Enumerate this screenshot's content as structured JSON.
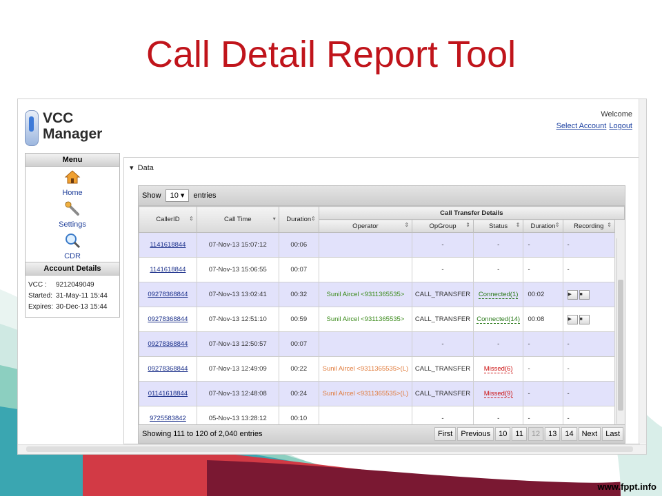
{
  "slide": {
    "title": "Call Detail Report Tool",
    "footer": "www.fppt.info"
  },
  "app": {
    "name_line1": "VCC",
    "name_line2": "Manager"
  },
  "header": {
    "welcome": "Welcome",
    "select_account": "Select Account",
    "logout": "Logout"
  },
  "sidebar": {
    "menu_title": "Menu",
    "items": [
      {
        "label": "Home",
        "icon": "home-icon"
      },
      {
        "label": "Settings",
        "icon": "wrench-icon"
      },
      {
        "label": "CDR",
        "icon": "magnifier-icon"
      }
    ],
    "account_title": "Account Details",
    "account": [
      {
        "k": "VCC :",
        "v": "9212049049"
      },
      {
        "k": "Started:",
        "v": "31-May-11 15:44"
      },
      {
        "k": "Expires:",
        "v": "30-Dec-13 15:44"
      }
    ]
  },
  "panel": {
    "title": "Data"
  },
  "table": {
    "show": "Show",
    "page_size": "10",
    "entries": "entries",
    "group_header": "Call Transfer Details",
    "columns": [
      "CallerID",
      "Call Time",
      "Duration",
      "Operator",
      "OpGroup",
      "Status",
      "Duration",
      "Recording"
    ],
    "rows": [
      {
        "caller": "1141618844",
        "time": "07-Nov-13 15:07:12",
        "dur": "00:06",
        "op": "",
        "opgroup": "-",
        "status": "-",
        "sdur": "-",
        "rec": "-",
        "style": "blue"
      },
      {
        "caller": "1141618844",
        "time": "07-Nov-13 15:06:55",
        "dur": "00:07",
        "op": "",
        "opgroup": "-",
        "status": "-",
        "sdur": "-",
        "rec": "-",
        "style": "white"
      },
      {
        "caller": "09278368844",
        "time": "07-Nov-13 13:02:41",
        "dur": "00:32",
        "op": "Sunil Aircel <9311365535>",
        "opgroup": "CALL_TRANSFER",
        "status": "Connected(1)",
        "sdur": "00:02",
        "rec": "play",
        "style": "blue",
        "opc": "green",
        "stc": "green"
      },
      {
        "caller": "09278368844",
        "time": "07-Nov-13 12:51:10",
        "dur": "00:59",
        "op": "Sunil Aircel <9311365535>",
        "opgroup": "CALL_TRANSFER",
        "status": "Connected(14)",
        "sdur": "00:08",
        "rec": "play",
        "style": "white",
        "opc": "green",
        "stc": "green"
      },
      {
        "caller": "09278368844",
        "time": "07-Nov-13 12:50:57",
        "dur": "00:07",
        "op": "",
        "opgroup": "-",
        "status": "-",
        "sdur": "-",
        "rec": "-",
        "style": "blue"
      },
      {
        "caller": "09278368844",
        "time": "07-Nov-13 12:49:09",
        "dur": "00:22",
        "op": "Sunil Aircel <9311365535>(L)",
        "opgroup": "CALL_TRANSFER",
        "status": "Missed(6)",
        "sdur": "-",
        "rec": "-",
        "style": "white",
        "opc": "orange",
        "stc": "red"
      },
      {
        "caller": "01141618844",
        "time": "07-Nov-13 12:48:08",
        "dur": "00:24",
        "op": "Sunil Aircel <9311365535>(L)",
        "opgroup": "CALL_TRANSFER",
        "status": "Missed(9)",
        "sdur": "-",
        "rec": "-",
        "style": "blue",
        "opc": "orange",
        "stc": "red"
      },
      {
        "caller": "9725583842",
        "time": "05-Nov-13 13:28:12",
        "dur": "00:10",
        "op": "",
        "opgroup": "-",
        "status": "-",
        "sdur": "-",
        "rec": "-",
        "style": "white"
      }
    ]
  },
  "pager": {
    "info": "Showing 111 to 120 of 2,040 entries",
    "buttons": [
      "First",
      "Previous",
      "10",
      "11",
      "12",
      "13",
      "14",
      "Next",
      "Last"
    ],
    "current": "12"
  }
}
